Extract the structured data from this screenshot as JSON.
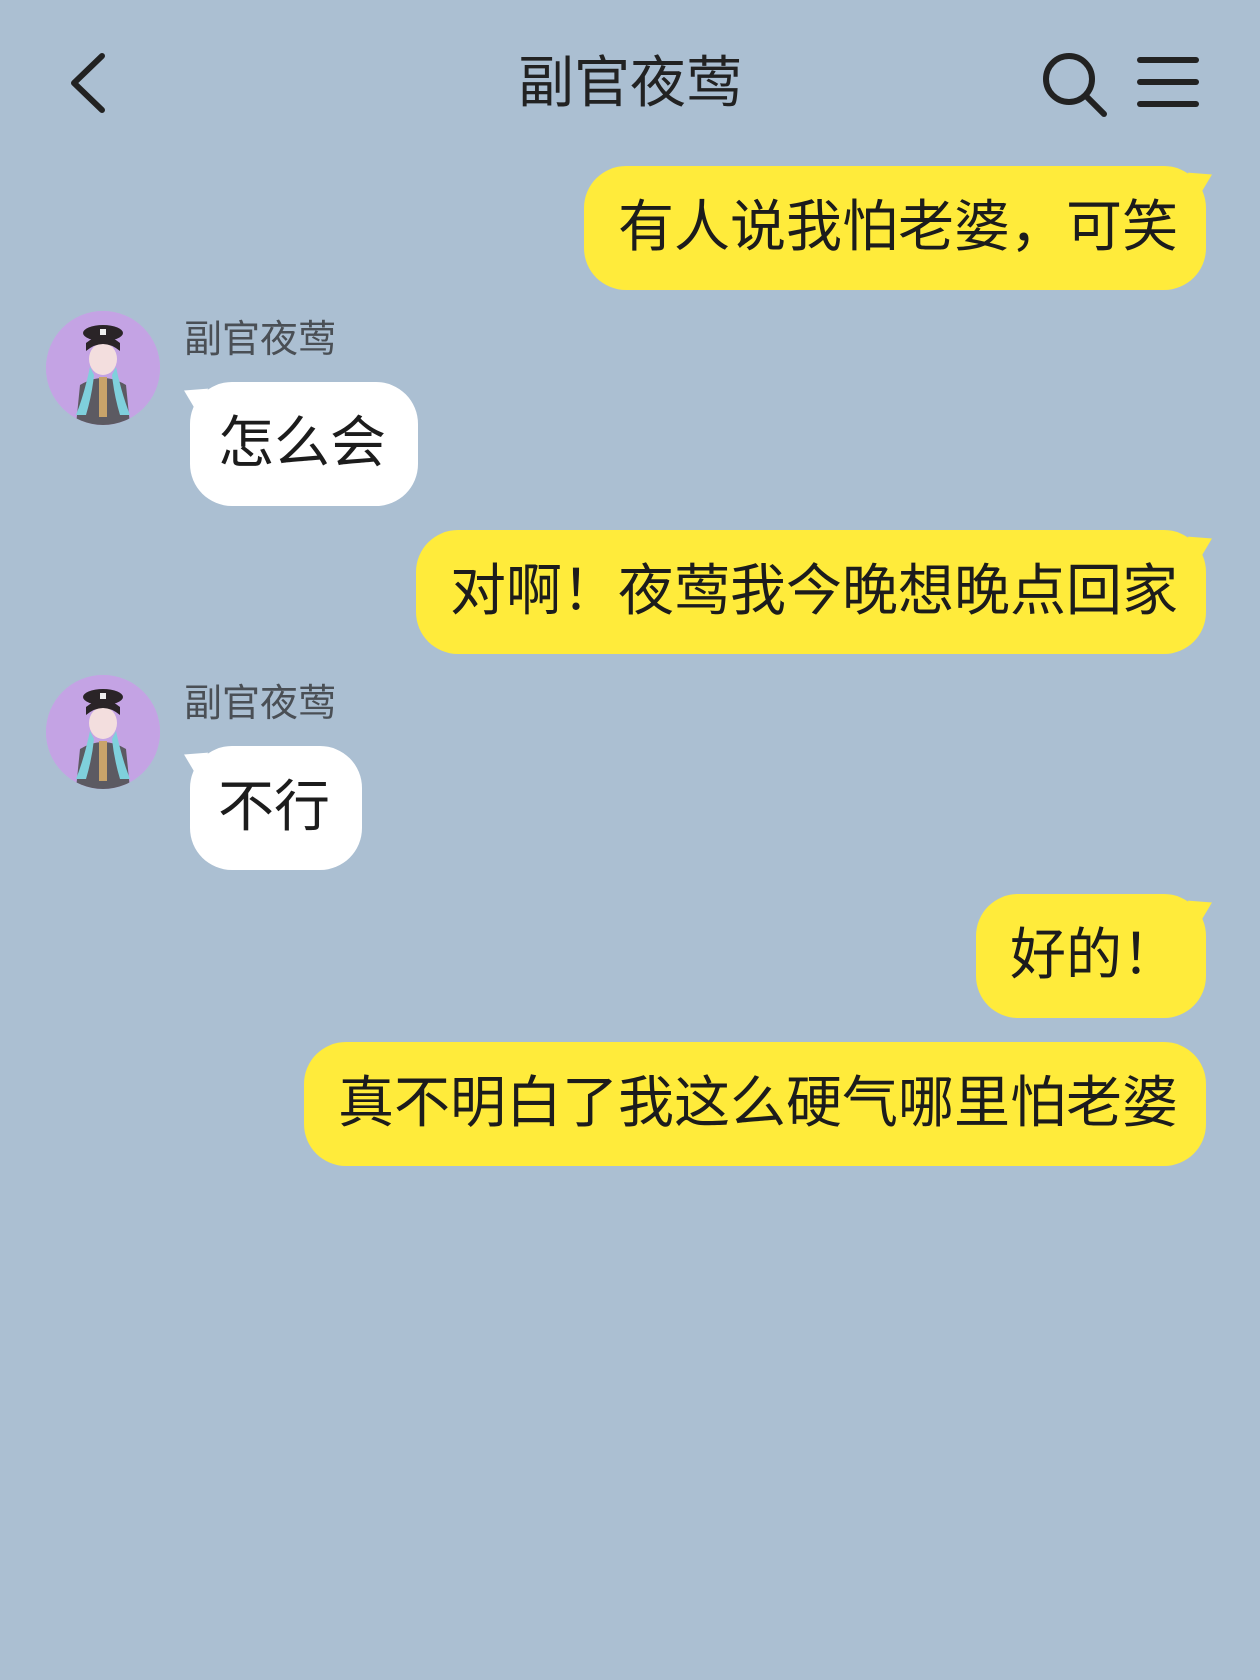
{
  "header": {
    "title": "副官夜莺",
    "back_icon": "chevron-left-icon",
    "search_icon": "search-icon",
    "menu_icon": "menu-icon"
  },
  "colors": {
    "background": "#abbfd2",
    "sent_bubble": "#ffeb3b",
    "received_bubble": "#ffffff"
  },
  "messages": [
    {
      "direction": "sent",
      "text": "有人说我怕老婆，可笑"
    },
    {
      "direction": "received",
      "sender": "副官夜莺",
      "text": "怎么会"
    },
    {
      "direction": "sent",
      "text": "对啊！夜莺我今晚想晚点回家"
    },
    {
      "direction": "received",
      "sender": "副官夜莺",
      "text": "不行"
    },
    {
      "direction": "sent",
      "text": "好的！"
    },
    {
      "direction": "sent",
      "text": "真不明白了我这么硬气哪里怕老婆"
    }
  ]
}
